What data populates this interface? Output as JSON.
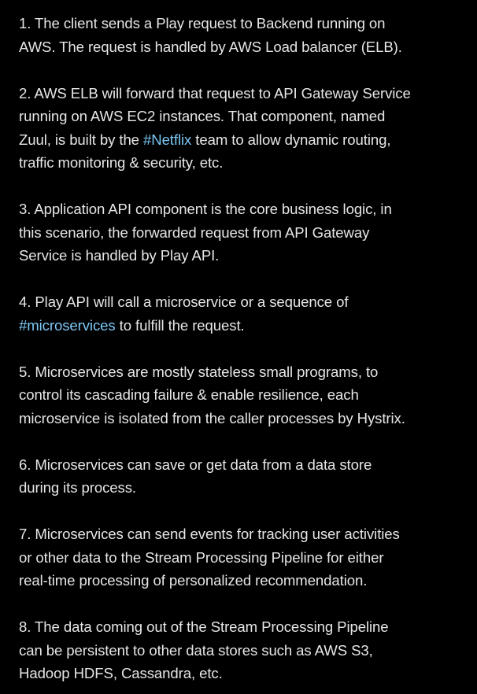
{
  "colors": {
    "background": "#000000",
    "text": "#e6e6e6",
    "hashtag": "#7cc7f5"
  },
  "paragraphs": [
    {
      "lines": [
        [
          "1. The client sends a Play request to Backend running on"
        ],
        [
          "AWS. The request is handled by AWS Load balancer (ELB)."
        ]
      ]
    },
    {
      "lines": [
        [
          "2. AWS ELB will forward that request to API Gateway Service"
        ],
        [
          "running on AWS EC2 instances. That component, named"
        ],
        [
          "Zuul, is built by the ",
          "#Netflix",
          " team to allow dynamic routing,"
        ],
        [
          "traffic monitoring & security, etc."
        ]
      ]
    },
    {
      "lines": [
        [
          "3. Application API component is the core business logic, in"
        ],
        [
          "this scenario, the forwarded request from API Gateway"
        ],
        [
          "Service is handled by Play API."
        ]
      ]
    },
    {
      "lines": [
        [
          "4. Play API will call a microservice or a sequence of"
        ],
        [
          "",
          "#microservices",
          " to fulfill the request."
        ]
      ]
    },
    {
      "lines": [
        [
          "5. Microservices are mostly stateless small programs, to"
        ],
        [
          "control its cascading failure & enable resilience, each"
        ],
        [
          "microservice is isolated from the caller processes by Hystrix."
        ]
      ]
    },
    {
      "lines": [
        [
          "6. Microservices can save or get data from a data store"
        ],
        [
          "during its process."
        ]
      ]
    },
    {
      "lines": [
        [
          "7. Microservices can send events for tracking user activities"
        ],
        [
          "or other data to the Stream Processing Pipeline for either"
        ],
        [
          "real-time processing of personalized recommendation."
        ]
      ]
    },
    {
      "lines": [
        [
          "8. The data coming out of the Stream Processing Pipeline"
        ],
        [
          "can be persistent to other data stores such as AWS S3,"
        ],
        [
          "Hadoop HDFS, Cassandra, etc."
        ]
      ]
    }
  ]
}
